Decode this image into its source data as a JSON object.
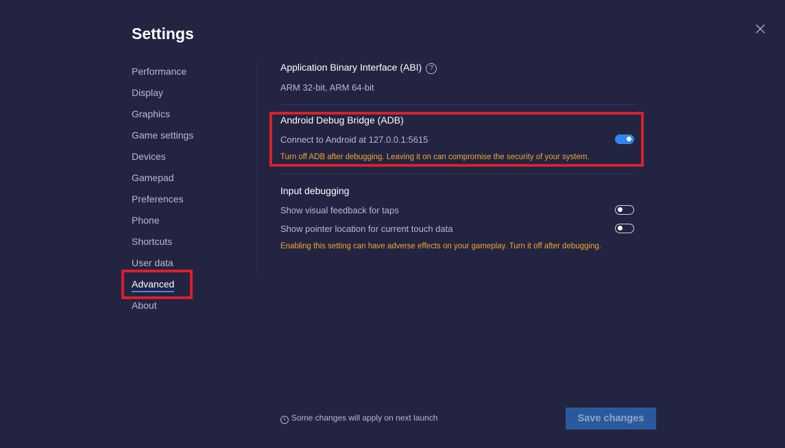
{
  "title": "Settings",
  "nav": {
    "items": [
      {
        "label": "Performance"
      },
      {
        "label": "Display"
      },
      {
        "label": "Graphics"
      },
      {
        "label": "Game settings"
      },
      {
        "label": "Devices"
      },
      {
        "label": "Gamepad"
      },
      {
        "label": "Preferences"
      },
      {
        "label": "Phone"
      },
      {
        "label": "Shortcuts"
      },
      {
        "label": "User data"
      },
      {
        "label": "Advanced"
      },
      {
        "label": "About"
      }
    ],
    "active": "Advanced"
  },
  "abi": {
    "heading": "Application Binary Interface (ABI)",
    "help_glyph": "?",
    "value": "ARM 32-bit, ARM 64-bit"
  },
  "adb": {
    "heading": "Android Debug Bridge (ADB)",
    "connect_label": "Connect to Android at 127.0.0.1:5615",
    "connect_on": true,
    "warning": "Turn off ADB after debugging. Leaving it on can compromise the security of your system."
  },
  "input_debugging": {
    "heading": "Input debugging",
    "visual_feedback_label": "Show visual feedback for taps",
    "visual_feedback_on": false,
    "pointer_location_label": "Show pointer location for current touch data",
    "pointer_location_on": false,
    "warning": "Enabling this setting can have adverse effects on your gameplay. Turn it off after debugging."
  },
  "footer": {
    "info_glyph": "i",
    "note": "Some changes will apply on next launch",
    "save_label": "Save changes"
  },
  "colors": {
    "background": "#232442",
    "accent": "#2f86f0",
    "warning": "#f2a72e",
    "highlight": "#d9202a"
  }
}
